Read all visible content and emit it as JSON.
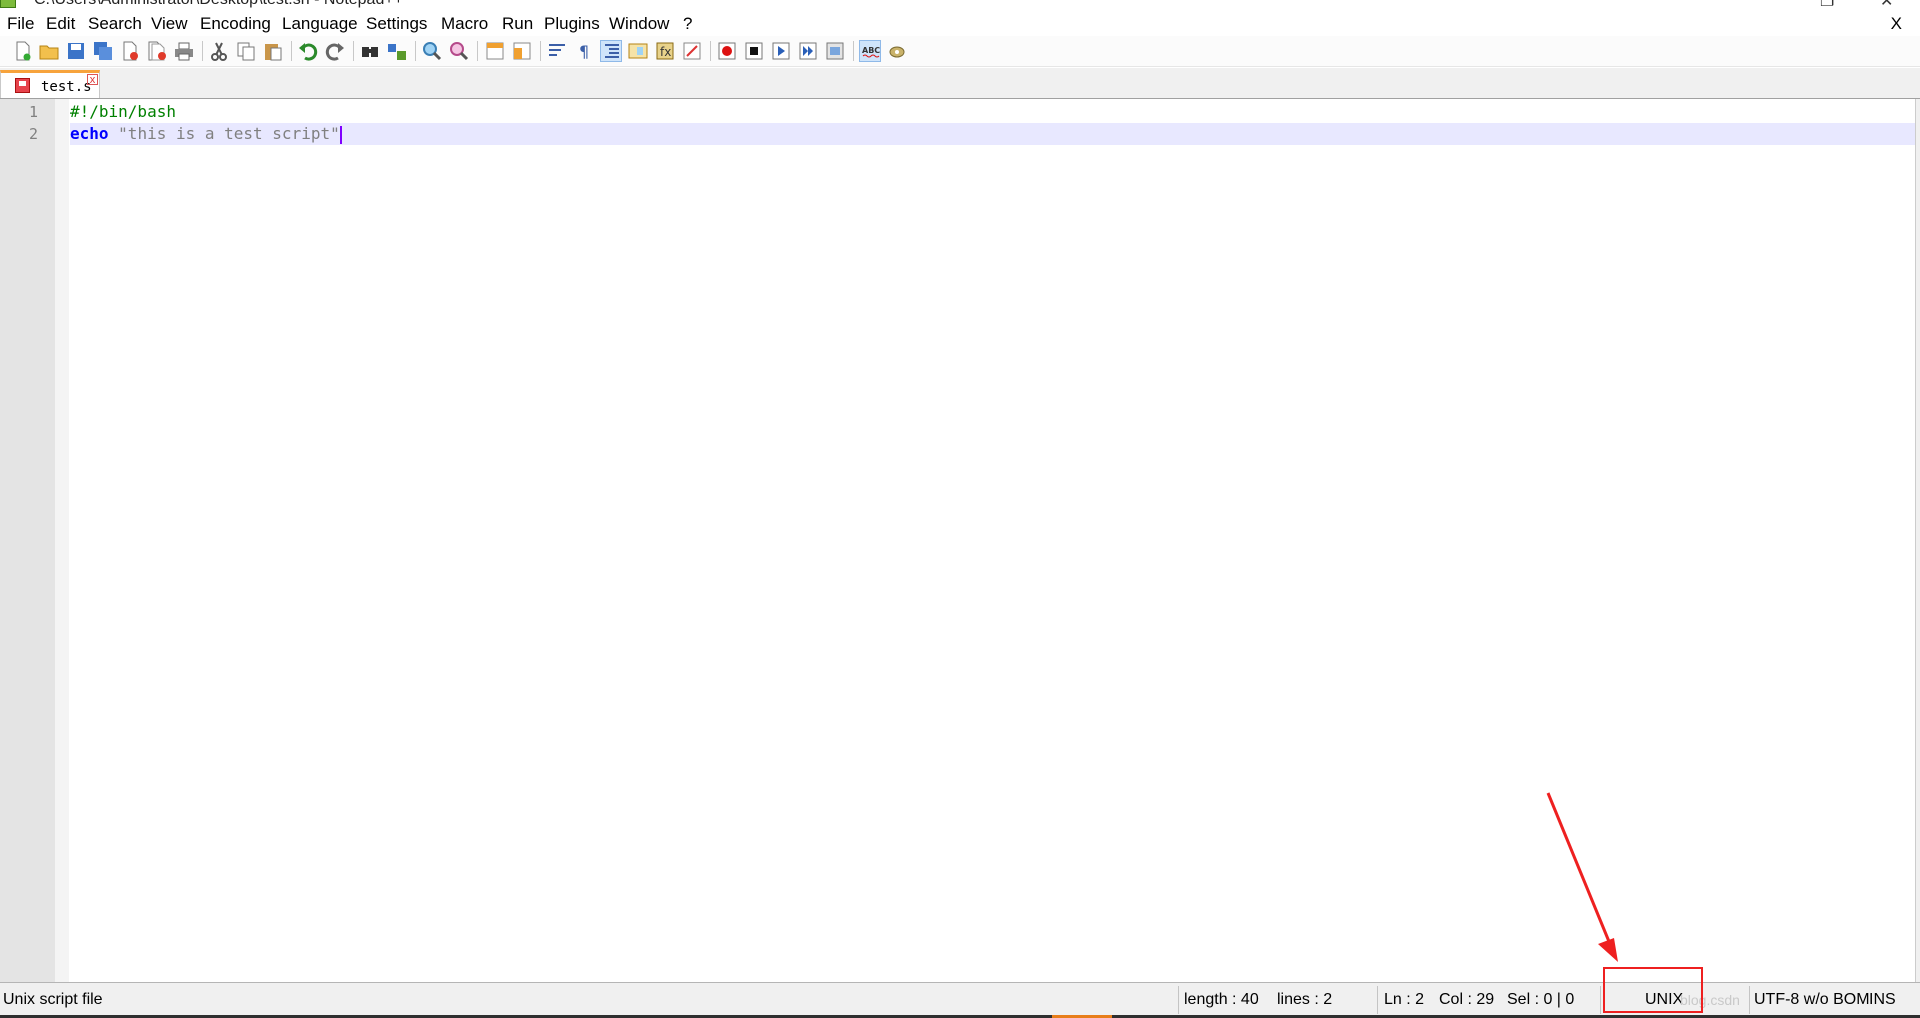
{
  "window": {
    "title": "C:\\Users\\Administrator\\Desktop\\test.sh - Notepad++",
    "app_icon": "notepadpp-icon",
    "controls": [
      "restore-icon",
      "close-icon"
    ]
  },
  "menu": {
    "items": [
      "File",
      "Edit",
      "Search",
      "View",
      "Encoding",
      "Language",
      "Settings",
      "Macro",
      "Run",
      "Plugins",
      "Window",
      "?"
    ],
    "close_doc_label": "X"
  },
  "toolbar": {
    "buttons": [
      "new-file-icon",
      "open-file-icon",
      "save-icon",
      "save-all-icon",
      "close-icon",
      "close-all-icon",
      "print-icon",
      "cut-icon",
      "copy-icon",
      "paste-icon",
      "undo-icon",
      "redo-icon",
      "find-icon",
      "replace-icon",
      "zoom-in-icon",
      "zoom-out-icon",
      "sync-vertical-icon",
      "sync-horizontal-icon",
      "word-wrap-icon",
      "show-all-characters-icon",
      "indent-guide-icon",
      "document-map-icon",
      "function-list-icon",
      "folder-as-workspace-icon",
      "record-macro-icon",
      "stop-recording-icon",
      "playback-macro-icon",
      "run-macro-multiple-icon",
      "save-macro-icon",
      "spell-check-icon",
      "plugin-icon"
    ]
  },
  "tabs": [
    {
      "label": "test.s",
      "icon": "save-icon",
      "close": "x"
    }
  ],
  "editor": {
    "lines": [
      {
        "number": "1",
        "tokens": [
          {
            "type": "comment",
            "text": "#!/bin/bash"
          }
        ]
      },
      {
        "number": "2",
        "tokens": [
          {
            "type": "keyword",
            "text": "echo"
          },
          {
            "type": "plain",
            "text": " "
          },
          {
            "type": "string",
            "text": "\"this is a test script\""
          }
        ],
        "current": true
      }
    ]
  },
  "status": {
    "file_type": "Unix script file",
    "length": "length : 40",
    "lines": "lines : 2",
    "ln": "Ln : 2",
    "col": "Col : 29",
    "sel": "Sel : 0 | 0",
    "eol": "UNIX",
    "encoding": "UTF-8 w/o BOM",
    "mode": "INS",
    "watermark": "blog.csdn"
  },
  "colors": {
    "annotation": "#ee2020",
    "comment": "#008000",
    "keyword": "#0000ff",
    "string": "#808080",
    "current_line": "#e8e8ff",
    "tab_accent": "#f7a33c"
  }
}
